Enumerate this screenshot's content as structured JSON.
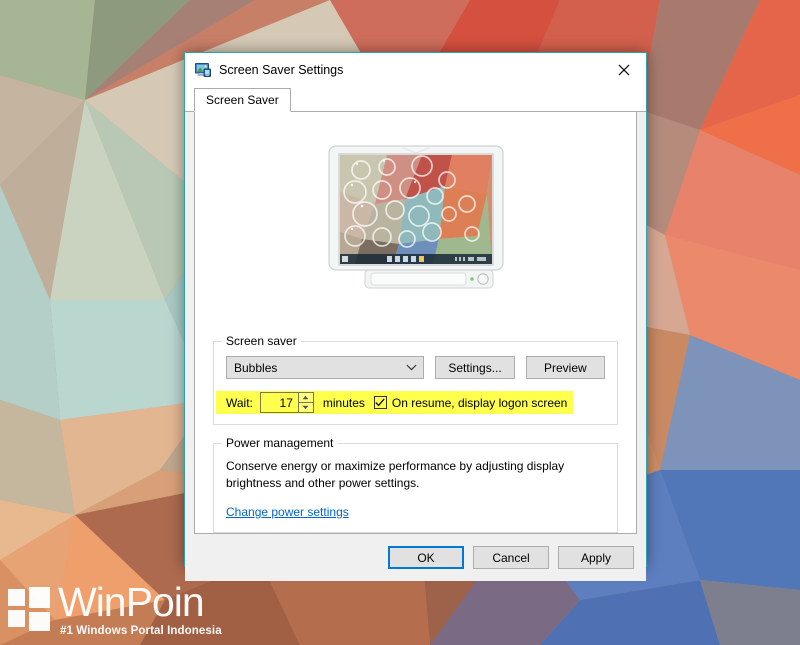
{
  "desktop": {
    "watermark": {
      "name": "WinPoin",
      "tagline": "#1 Windows Portal Indonesia",
      "logo_icon": "windows-squares-logo"
    }
  },
  "dialog": {
    "title": "Screen Saver Settings",
    "title_icon": "display-monitor-icon",
    "close_icon": "close-icon",
    "tabs": [
      {
        "label": "Screen Saver",
        "active": true
      }
    ],
    "preview": {
      "icon": "monitor-preview",
      "description": "Monitor showing Bubbles screen saver over low-poly desktop wallpaper"
    },
    "screen_saver_group": {
      "legend": "Screen saver",
      "combo": {
        "value": "Bubbles",
        "chevron_icon": "chevron-down-icon"
      },
      "settings_button": "Settings...",
      "preview_button": "Preview",
      "wait": {
        "label": "Wait:",
        "value": "17",
        "units": "minutes",
        "spinner_up_icon": "spinner-up-icon",
        "spinner_down_icon": "spinner-down-icon",
        "highlight_color": "#ffff4d"
      },
      "on_resume": {
        "label": "On resume, display logon screen",
        "checked": true,
        "check_icon": "checkmark-icon"
      }
    },
    "power_group": {
      "legend": "Power management",
      "description_line1": "Conserve energy or maximize performance by adjusting display",
      "description_line2": "brightness and other power settings.",
      "link": "Change power settings",
      "link_color": "#0066cc"
    },
    "buttons": {
      "ok": "OK",
      "cancel": "Cancel",
      "apply": "Apply",
      "default_focus": "ok",
      "focus_color": "#0078d7"
    }
  }
}
